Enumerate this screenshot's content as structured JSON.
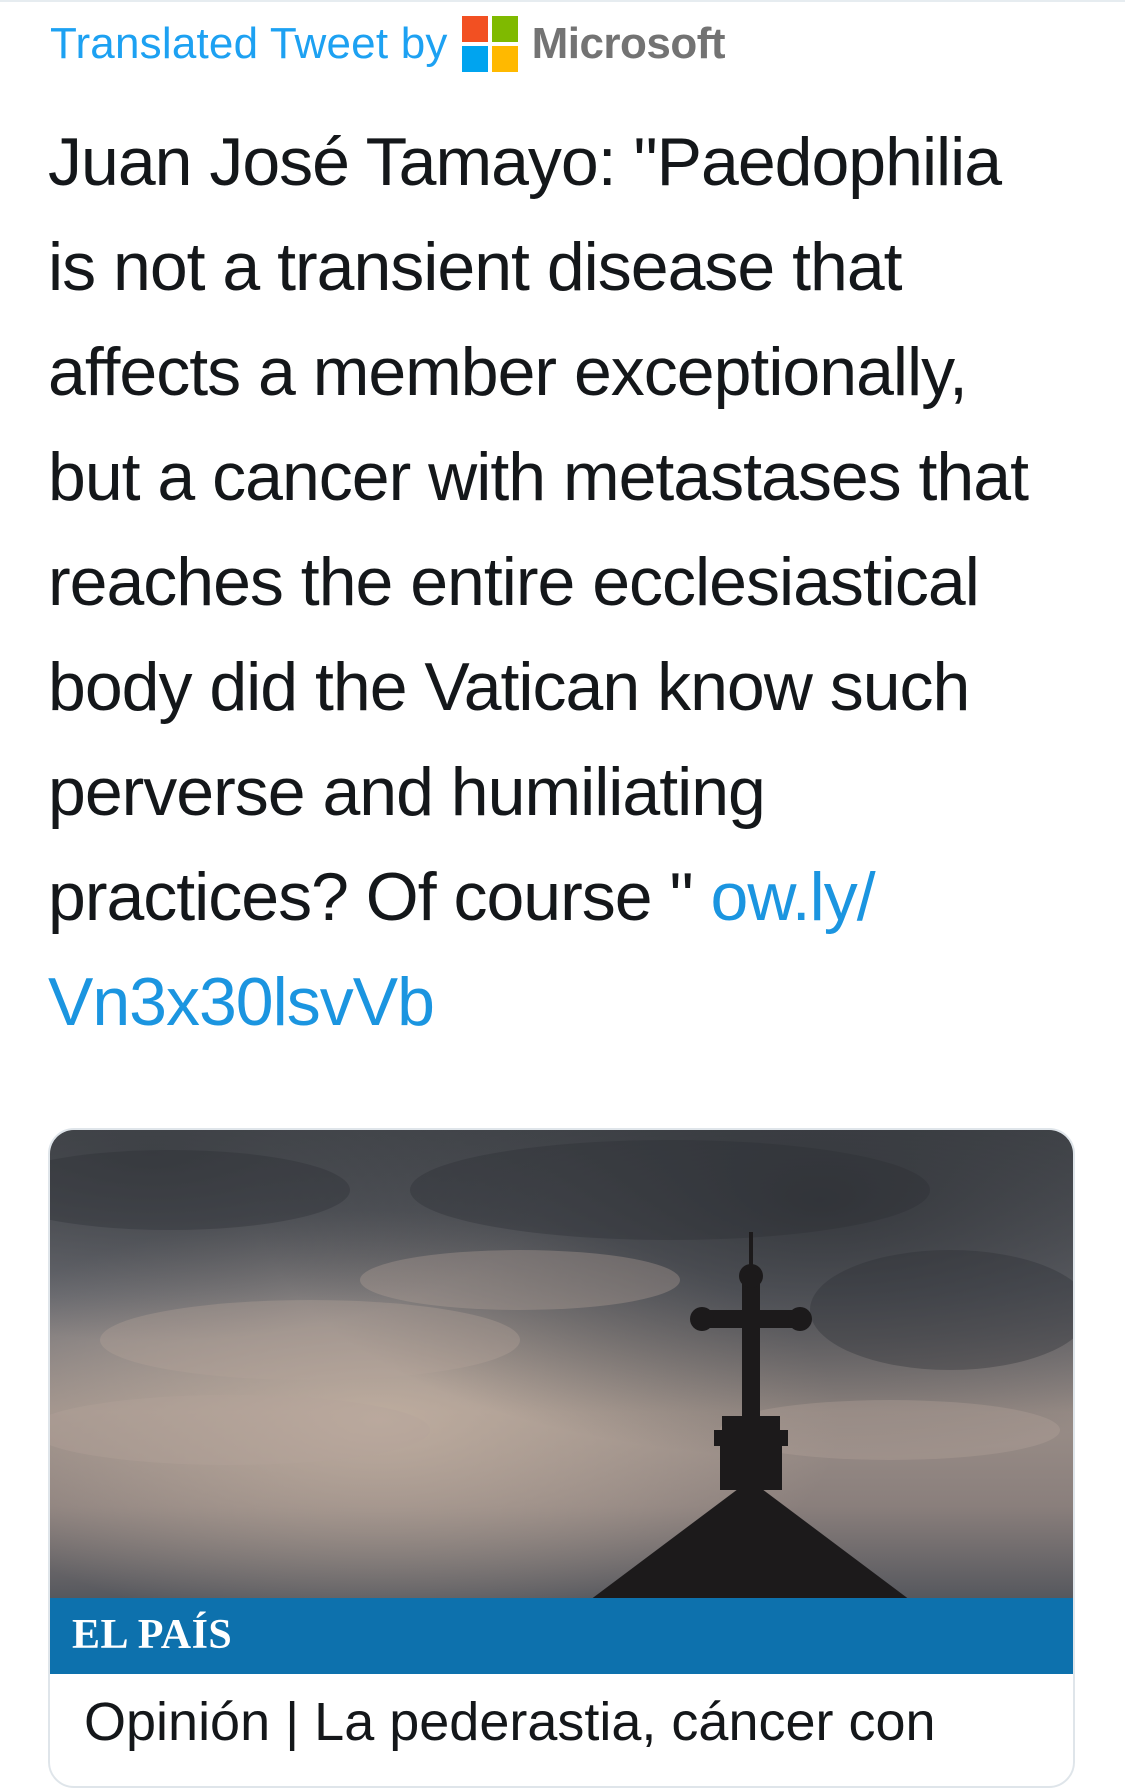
{
  "translation_header": {
    "label": "Translated Tweet by",
    "provider": "Microsoft",
    "logo_icon": "microsoft-logo-icon",
    "logo_colors": [
      "#f25022",
      "#7fba00",
      "#00a4ef",
      "#ffb900"
    ],
    "label_color": "#1da1f2"
  },
  "tweet": {
    "text": "Juan José Tamayo: \"Paedophilia\nis not a transient disease that\naffects a member exceptionally,\nbut a cancer with metastases that\nreaches the entire ecclesiastical\nbody did the Vatican know such\nperverse and humiliating\npractices? Of course \" ",
    "link": "ow.ly/\nVn3x30lsvVb",
    "link_color": "#1b95e0"
  },
  "link_card": {
    "image_icon": "church-cross-photo",
    "source": "EL PAÍS",
    "source_bar_color": "#0d71ad",
    "title": "Opinión | La pederastia, cáncer con"
  }
}
